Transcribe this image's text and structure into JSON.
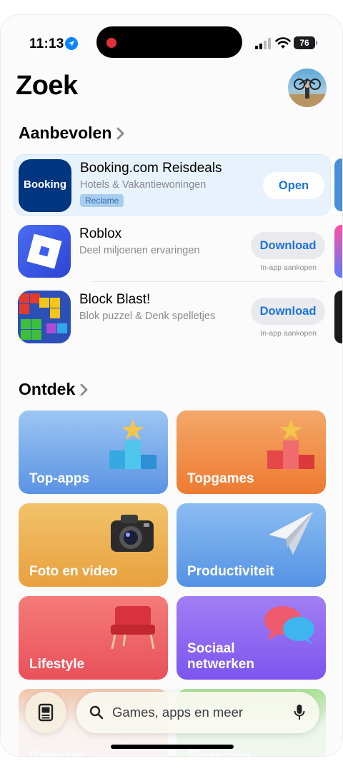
{
  "status_bar": {
    "time": "11:13",
    "battery": "76"
  },
  "header": {
    "title": "Zoek"
  },
  "recommended": {
    "title": "Aanbevolen",
    "apps": [
      {
        "name": "Booking.com Reisdeals",
        "subtitle": "Hotels & Vakantiewoningen",
        "badge": "Reclame",
        "button": "Open",
        "icon_text": "Booking",
        "icon_color": "#003580"
      },
      {
        "name": "Roblox",
        "subtitle": "Deel miljoenen ervaringen",
        "button": "Download",
        "note": "In-app aankopen",
        "icon_color": "#3d5ef0"
      },
      {
        "name": "Block Blast!",
        "subtitle": "Blok puzzel & Denk spelletjes",
        "button": "Download",
        "note": "In-app aankopen",
        "icon_color": "#2d4fb8"
      }
    ]
  },
  "discover": {
    "title": "Ontdek",
    "tiles": [
      {
        "label": "Top-apps",
        "color": "#6fa6e6"
      },
      {
        "label": "Topgames",
        "color": "#f08a3e"
      },
      {
        "label": "Foto en video",
        "color": "#eaa94a"
      },
      {
        "label": "Productiviteit",
        "color": "#5f9be6"
      },
      {
        "label": "Lifestyle",
        "color": "#ee5e62"
      },
      {
        "label": "Sociaal netwerken",
        "color": "#8a62ef"
      },
      {
        "label": "Diensten",
        "color": "#e8b59a"
      },
      {
        "label": "Financiën",
        "color": "#8ed37a"
      }
    ]
  },
  "search": {
    "placeholder": "Games, apps en meer"
  },
  "colors": {
    "accent": "#1a73d9",
    "featured_bg": "#e8f2fc"
  }
}
